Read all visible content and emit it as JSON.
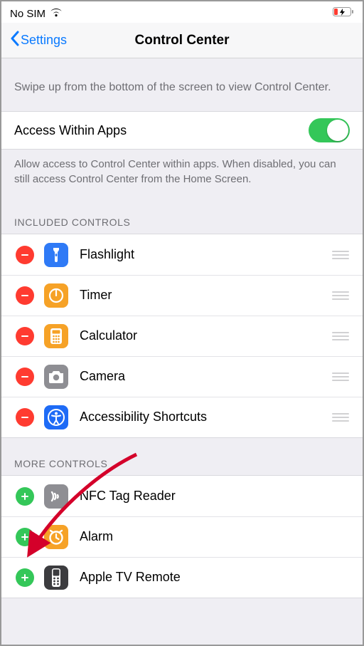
{
  "status": {
    "carrier": "No SIM"
  },
  "nav": {
    "back": "Settings",
    "title": "Control Center"
  },
  "hint": "Swipe up from the bottom of the screen to view Control Center.",
  "access": {
    "label": "Access Within Apps",
    "enabled": true
  },
  "subhint": "Allow access to Control Center within apps. When disabled, you can still access Control Center from the Home Screen.",
  "sections": {
    "included": {
      "header": "INCLUDED CONTROLS"
    },
    "more": {
      "header": "MORE CONTROLS"
    }
  },
  "included": [
    {
      "id": "flashlight",
      "label": "Flashlight"
    },
    {
      "id": "timer",
      "label": "Timer"
    },
    {
      "id": "calculator",
      "label": "Calculator"
    },
    {
      "id": "camera",
      "label": "Camera"
    },
    {
      "id": "accessibility",
      "label": "Accessibility Shortcuts"
    }
  ],
  "more": [
    {
      "id": "nfc",
      "label": "NFC Tag Reader"
    },
    {
      "id": "alarm",
      "label": "Alarm"
    },
    {
      "id": "appletv",
      "label": "Apple TV Remote"
    }
  ]
}
